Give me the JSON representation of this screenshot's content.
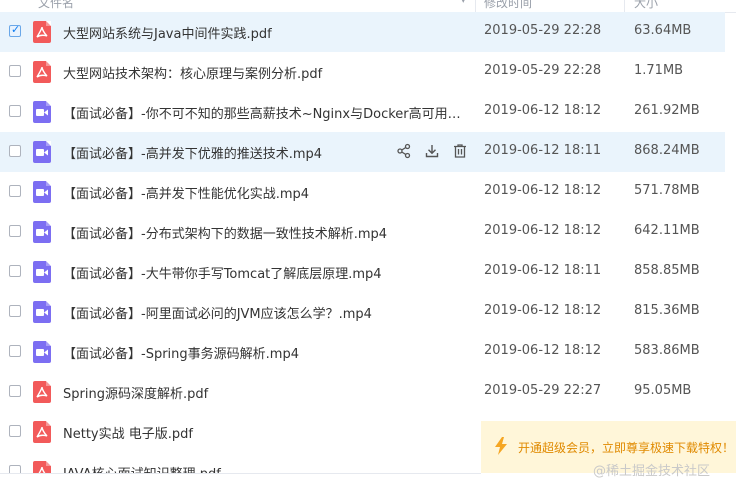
{
  "header": {
    "col_name": "文件名",
    "col_date": "修改时间",
    "col_size": "大小"
  },
  "files": [
    {
      "name": "大型网站系统与Java中间件实践.pdf",
      "date": "2019-05-29 22:28",
      "size": "63.64MB",
      "type": "pdf",
      "checked": true
    },
    {
      "name": "大型网站技术架构：核心原理与案例分析.pdf",
      "date": "2019-05-29 22:28",
      "size": "1.71MB",
      "type": "pdf",
      "checked": false
    },
    {
      "name": "【面试必备】-你不可不知的那些高薪技术~Nginx与Docker高可用集群实...",
      "date": "2019-06-12 18:12",
      "size": "261.92MB",
      "type": "video",
      "checked": false
    },
    {
      "name": "【面试必备】-高并发下优雅的推送技术.mp4",
      "date": "2019-06-12 18:11",
      "size": "868.24MB",
      "type": "video",
      "checked": false
    },
    {
      "name": "【面试必备】-高并发下性能优化实战.mp4",
      "date": "2019-06-12 18:12",
      "size": "571.78MB",
      "type": "video",
      "checked": false
    },
    {
      "name": "【面试必备】-分布式架构下的数据一致性技术解析.mp4",
      "date": "2019-06-12 18:12",
      "size": "642.11MB",
      "type": "video",
      "checked": false
    },
    {
      "name": "【面试必备】-大牛带你手写Tomcat了解底层原理.mp4",
      "date": "2019-06-12 18:11",
      "size": "858.85MB",
      "type": "video",
      "checked": false
    },
    {
      "name": "【面试必备】-阿里面试必问的JVM应该怎么学？.mp4",
      "date": "2019-06-12 18:12",
      "size": "815.36MB",
      "type": "video",
      "checked": false
    },
    {
      "name": "【面试必备】-Spring事务源码解析.mp4",
      "date": "2019-06-12 18:12",
      "size": "583.86MB",
      "type": "video",
      "checked": false
    },
    {
      "name": "Spring源码深度解析.pdf",
      "date": "2019-05-29 22:27",
      "size": "95.05MB",
      "type": "pdf",
      "checked": false
    },
    {
      "name": "Netty实战 电子版.pdf",
      "date": "",
      "size": "",
      "type": "pdf",
      "checked": false
    },
    {
      "name": "JAVA核心面试知识整理.pdf",
      "date": "",
      "size": "",
      "type": "pdf",
      "checked": false
    }
  ],
  "row_actions": {
    "share_icon": "share-icon",
    "download_icon": "download-icon",
    "delete_icon": "trash-icon"
  },
  "promo": {
    "text": "开通超级会员，立即尊享极速下载特权！",
    "icon": "lightning-icon"
  },
  "watermark": "@稀土掘金技术社区",
  "colors": {
    "selected_row": "#eaf4fc",
    "pdf_icon": "#f25a5a",
    "video_icon": "#7c6ef2",
    "promo_bg": "#fff6d9",
    "promo_text": "#e08a00",
    "checkbox_accent": "#0d7cf2"
  }
}
